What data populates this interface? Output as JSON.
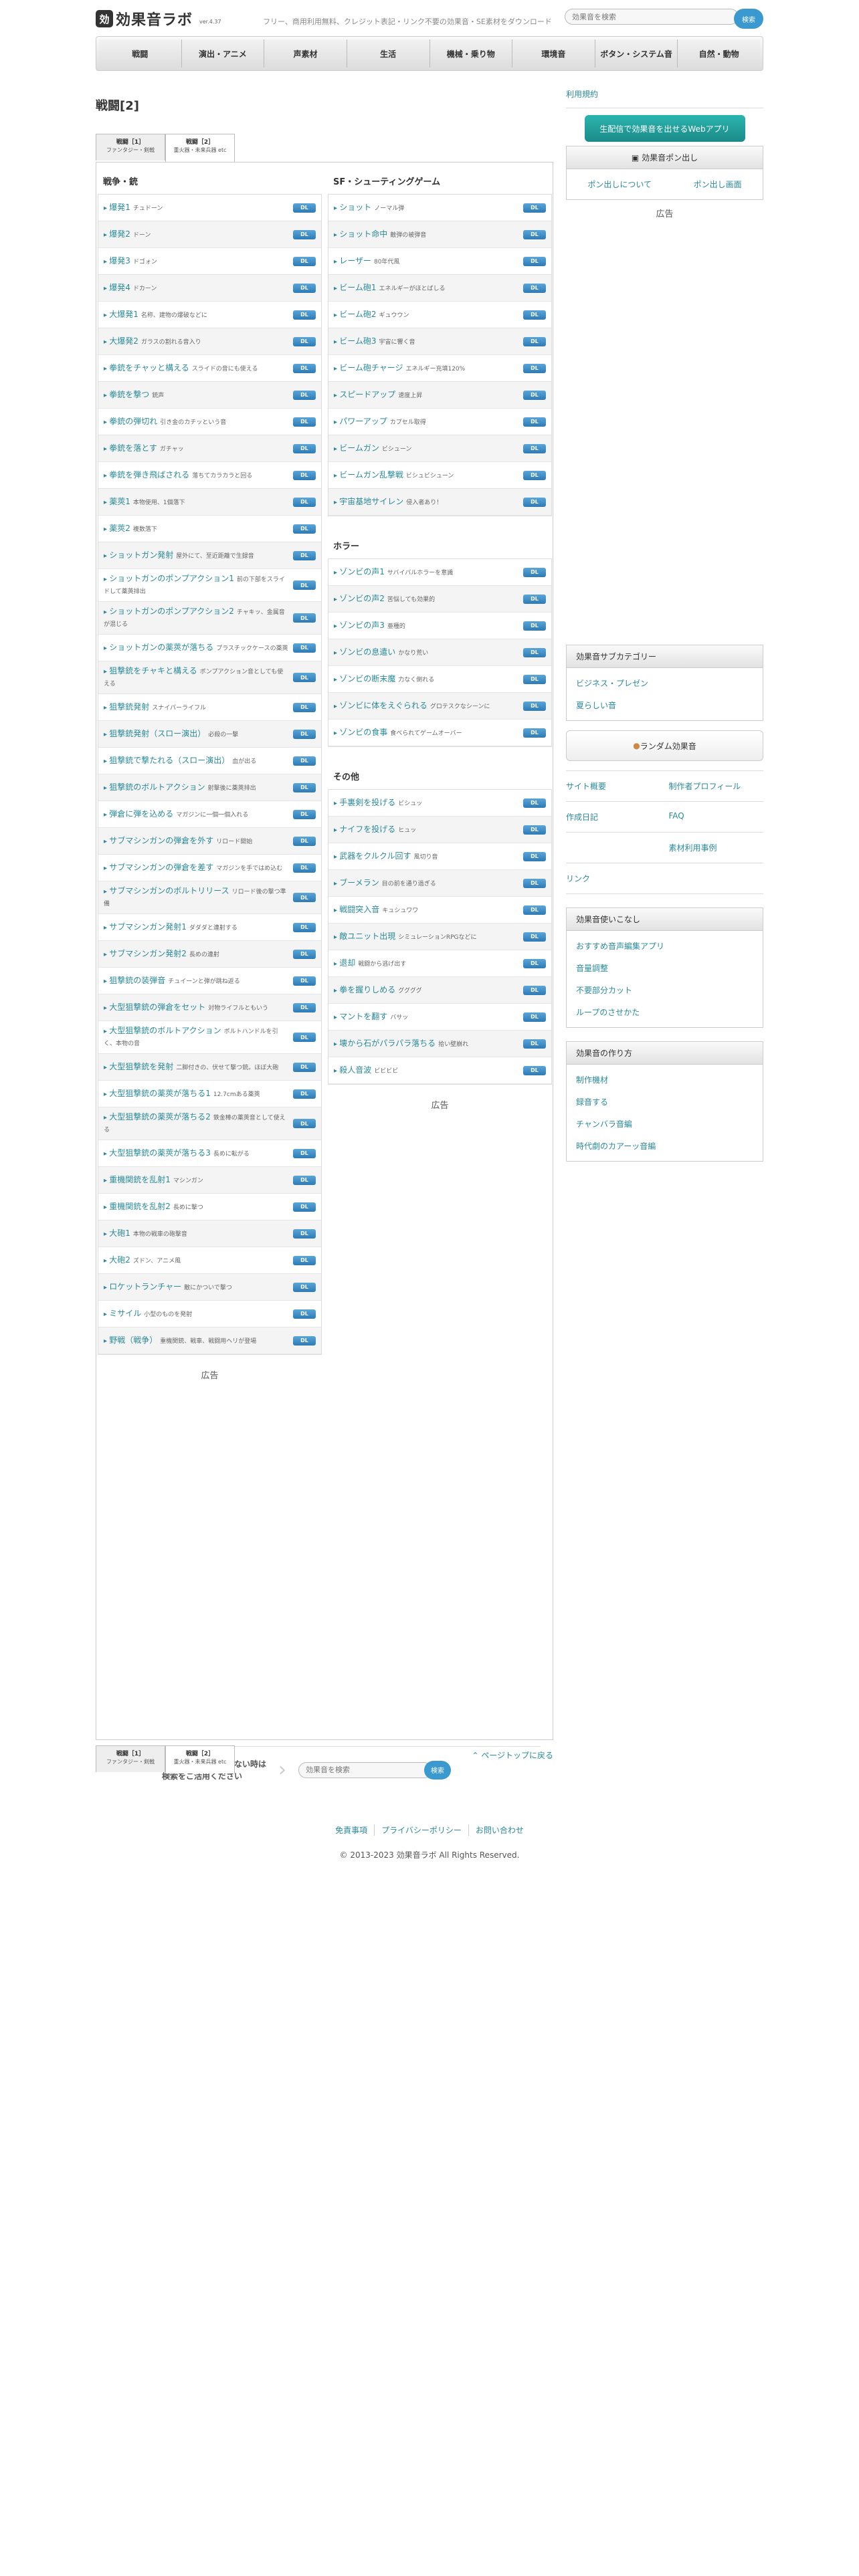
{
  "header": {
    "logo_mark": "効",
    "logo_text": "効果音ラボ",
    "logo_ver": "ver.4.37",
    "tagline": "フリー、商用利用無料、クレジット表記・リンク不要の効果音・SE素材をダウンロード",
    "search_placeholder": "効果音を検索",
    "search_button": "検索"
  },
  "nav": [
    "戦闘",
    "演出・アニメ",
    "声素材",
    "生活",
    "機械・乗り物",
    "環境音",
    "ボタン・システム音",
    "自然・動物"
  ],
  "main": {
    "title": "戦闘[2]",
    "tabs": [
      {
        "label": "戦闘［1］",
        "sub": "ファンタジー・剣戟"
      },
      {
        "label": "戦闘［2］",
        "sub": "重火器・未来兵器 etc"
      }
    ],
    "download_label": "DL",
    "left_section": "戦争・銃",
    "left_rows": [
      {
        "t": "爆発1",
        "d": "チュドーン"
      },
      {
        "t": "爆発2",
        "d": "ドーン"
      },
      {
        "t": "爆発3",
        "d": "ドゴォン"
      },
      {
        "t": "爆発4",
        "d": "ドカーン"
      },
      {
        "t": "大爆発1",
        "d": "名称、建物の爆破などに"
      },
      {
        "t": "大爆発2",
        "d": "ガラスの割れる音入り"
      },
      {
        "t": "拳銃をチャッと構える",
        "d": "スライドの音にも使える"
      },
      {
        "t": "拳銃を撃つ",
        "d": "銃声"
      },
      {
        "t": "拳銃の弾切れ",
        "d": "引き金のカチッという音"
      },
      {
        "t": "拳銃を落とす",
        "d": "ガチャッ"
      },
      {
        "t": "拳銃を弾き飛ばされる",
        "d": "落ちてカラカラと回る"
      },
      {
        "t": "薬莢1",
        "d": "本物使用、1個落下"
      },
      {
        "t": "薬莢2",
        "d": "複数落下"
      },
      {
        "t": "ショットガン発射",
        "d": "屋外にて、至近距離で生録音"
      },
      {
        "t": "ショットガンのポンプアクション1",
        "d": "前の下部をスライドして薬莢排出"
      },
      {
        "t": "ショットガンのポンプアクション2",
        "d": "チャキッ、金属音が混じる"
      },
      {
        "t": "ショットガンの薬莢が落ちる",
        "d": "プラスチックケースの薬莢"
      },
      {
        "t": "狙撃銃をチャキと構える",
        "d": "ボンプアクション音としても使える"
      },
      {
        "t": "狙撃銃発射",
        "d": "スナイパーライフル"
      },
      {
        "t": "狙撃銃発射（スロー演出）",
        "d": "必殺の一撃"
      },
      {
        "t": "狙撃銃で撃たれる（スロー演出）",
        "d": "血が出る"
      },
      {
        "t": "狙撃銃のボルトアクション",
        "d": "射撃後に薬莢排出"
      },
      {
        "t": "弾倉に弾を込める",
        "d": "マガジンに一個一個入れる"
      },
      {
        "t": "サブマシンガンの弾倉を外す",
        "d": "リロード開始"
      },
      {
        "t": "サブマシンガンの弾倉を差す",
        "d": "マガジンを手ではめ込む"
      },
      {
        "t": "サブマシンガンのボルトリリース",
        "d": "リロード後の撃つ準備"
      },
      {
        "t": "サブマシンガン発射1",
        "d": "ダダダと連射する"
      },
      {
        "t": "サブマシンガン発射2",
        "d": "長めの連射"
      },
      {
        "t": "狙撃銃の装弾音",
        "d": "チュイーンと弾が跳ね返る"
      },
      {
        "t": "大型狙撃銃の弾倉をセット",
        "d": "対物ライフルともいう"
      },
      {
        "t": "大型狙撃銃のボルトアクション",
        "d": "ボルトハンドルを引く、本物の音"
      },
      {
        "t": "大型狙撃銃を発射",
        "d": "二脚付きの、伏せて撃つ銃。ほぼ大砲"
      },
      {
        "t": "大型狙撃銃の薬莢が落ちる1",
        "d": "12.7cmある薬莢"
      },
      {
        "t": "大型狙撃銃の薬莢が落ちる2",
        "d": "鉄金棒の薬莢音として使える"
      },
      {
        "t": "大型狙撃銃の薬莢が落ちる3",
        "d": "長めに転がる"
      },
      {
        "t": "重機関銃を乱射1",
        "d": "マシンガン"
      },
      {
        "t": "重機関銃を乱射2",
        "d": "長めに撃つ"
      },
      {
        "t": "大砲1",
        "d": "本物の戦車の砲撃音"
      },
      {
        "t": "大砲2",
        "d": "ズドン、アニメ風"
      },
      {
        "t": "ロケットランチャー",
        "d": "敵にかついで撃つ"
      },
      {
        "t": "ミサイル",
        "d": "小型のものを発射"
      },
      {
        "t": "野戦（戦争）",
        "d": "重機関銃、戦車、戦闘用ヘリが登場"
      }
    ],
    "right_section_1": "SF・シューティングゲーム",
    "right_rows_1": [
      {
        "t": "ショット",
        "d": "ノーマル弾"
      },
      {
        "t": "ショット命中",
        "d": "敵弾の被弾音"
      },
      {
        "t": "レーザー",
        "d": "80年代風"
      },
      {
        "t": "ビーム砲1",
        "d": "エネルギーがほとばしる"
      },
      {
        "t": "ビーム砲2",
        "d": "ギュウウン"
      },
      {
        "t": "ビーム砲3",
        "d": "宇宙に響く音"
      },
      {
        "t": "ビーム砲チャージ",
        "d": "エネルギー充填120%"
      },
      {
        "t": "スピードアップ",
        "d": "速度上昇"
      },
      {
        "t": "パワーアップ",
        "d": "カプセル取得"
      },
      {
        "t": "ビームガン",
        "d": "ビシューン"
      },
      {
        "t": "ビームガン乱撃戦",
        "d": "ビシュビシューン"
      },
      {
        "t": "宇宙基地サイレン",
        "d": "侵入者あり！"
      }
    ],
    "right_section_2": "ホラー",
    "right_rows_2": [
      {
        "t": "ゾンビの声1",
        "d": "サバイバルホラーを意識"
      },
      {
        "t": "ゾンビの声2",
        "d": "苦悩しても効果的"
      },
      {
        "t": "ゾンビの声3",
        "d": "亜種的"
      },
      {
        "t": "ゾンビの息遣い",
        "d": "かなり荒い"
      },
      {
        "t": "ゾンビの断末魔",
        "d": "力なく倒れる"
      },
      {
        "t": "ゾンビに体をえぐられる",
        "d": "グロテスクなシーンに"
      },
      {
        "t": "ゾンビの食事",
        "d": "食べられてゲームオーバー"
      }
    ],
    "right_section_3": "その他",
    "right_rows_3": [
      {
        "t": "手裏剣を投げる",
        "d": "ビシュッ"
      },
      {
        "t": "ナイフを投げる",
        "d": "ヒュッ"
      },
      {
        "t": "武器をクルクル回す",
        "d": "風切り音"
      },
      {
        "t": "ブーメラン",
        "d": "目の前を通り過ぎる"
      },
      {
        "t": "戦闘突入音",
        "d": "キュシュワワ"
      },
      {
        "t": "敵ユニット出現",
        "d": "シミュレーションRPGなどに"
      },
      {
        "t": "退却",
        "d": "戦闘から逃げ出す"
      },
      {
        "t": "拳を握りしめる",
        "d": "ググググ"
      },
      {
        "t": "マントを翻す",
        "d": "バサッ"
      },
      {
        "t": "壊から石がパラパラ落ちる",
        "d": "拾い壁崩れ"
      },
      {
        "t": "殺人音波",
        "d": "ビビビビ"
      }
    ],
    "ad_label": "広告",
    "bottom_msg_1": "目的の音が見つからない時は",
    "bottom_msg_2": "検索をご活用ください",
    "bottom_search_placeholder": "効果音を検索",
    "bottom_search_button": "検索",
    "page_top": "ページトップに戻る"
  },
  "sidebar": {
    "terms": "利用規約",
    "app_button": "生配信で効果音を出せるWebアプリ",
    "pon_title": "効果音ポン出し",
    "pon_links": [
      "ポン出しについて",
      "ポン出し画面"
    ],
    "ad_label": "広告",
    "sub_title": "効果音サブカテゴリー",
    "sub_items": [
      "ビジネス・プレゼン",
      "夏らしい音"
    ],
    "random": "ランダム効果音",
    "grid": [
      "サイト概要",
      "制作者プロフィール",
      "作成日記",
      "FAQ",
      "",
      "素材利用事例",
      "リンク",
      ""
    ],
    "howto_title": "効果音使いこなし",
    "howto_items": [
      "おすすめ音声編集アプリ",
      "音量調整",
      "不要部分カット",
      "ループのさせかた"
    ],
    "make_title": "効果音の作り方",
    "make_items": [
      "制作機材",
      "録音する",
      "チャンバラ音編",
      "時代劇のカアーッ音編"
    ]
  },
  "footer": {
    "links": [
      "免責事項",
      "プライバシーポリシー",
      "お問い合わせ"
    ],
    "copyright": "© 2013-2023 効果音ラボ All Rights Reserved."
  }
}
